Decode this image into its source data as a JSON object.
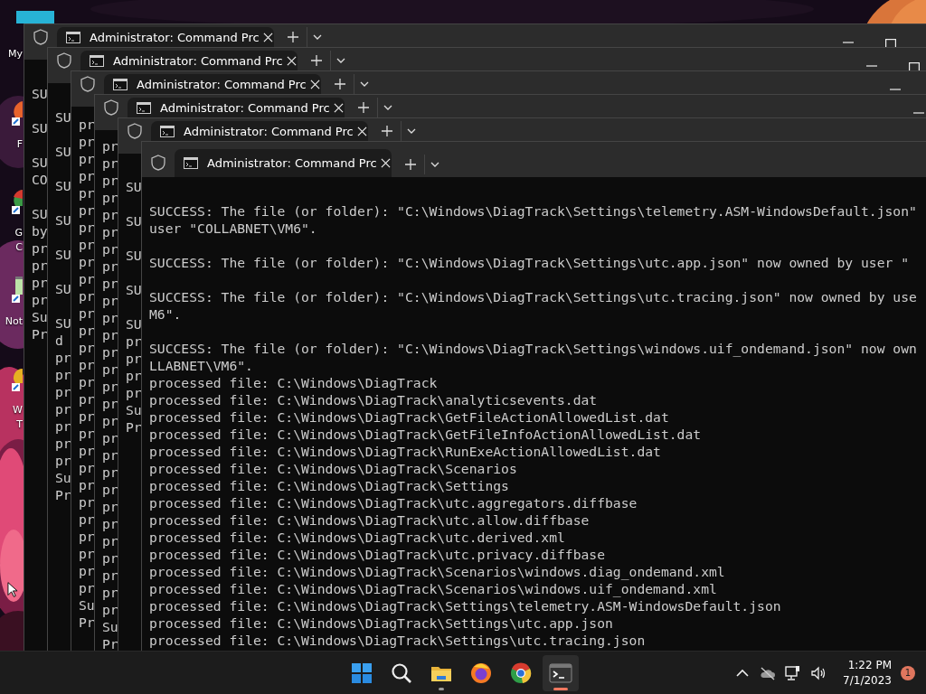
{
  "desktop": {
    "icons": [
      {
        "kind": "computer",
        "label_lines": [
          "My"
        ]
      },
      {
        "kind": "orange-app",
        "label_lines": [
          "F"
        ]
      },
      {
        "kind": "round-app",
        "label_lines": [
          "G",
          "C"
        ]
      },
      {
        "kind": "notepad",
        "label_lines": [
          "Not"
        ]
      },
      {
        "kind": "yellow-app",
        "label_lines": [
          "W",
          "T"
        ]
      }
    ]
  },
  "windows": [
    {
      "tab_title": "Administrator: Command Prc",
      "blocks": [
        [
          "SU"
        ],
        [
          "SU"
        ],
        [
          "SU",
          "CO"
        ],
        [
          "SU",
          "by",
          "pr",
          "pr",
          "pr",
          "pr",
          "Su",
          "Pr"
        ]
      ]
    },
    {
      "tab_title": "Administrator: Command Prc",
      "blocks": [
        [
          "SU"
        ],
        [
          "SU"
        ],
        [
          "SU"
        ],
        [
          "SU"
        ],
        [
          "SU"
        ],
        [
          "SU"
        ],
        [
          "SU",
          "d",
          "pr",
          "pr",
          "pr",
          "pr",
          "pr",
          "pr",
          "pr",
          "Su",
          "Pr"
        ]
      ]
    },
    {
      "tab_title": "Administrator: Command Prc",
      "blocks": [
        [
          "pr",
          "pr",
          "pr",
          "pr",
          "pr",
          "pr",
          "pr",
          "pr",
          "pr",
          "pr",
          "pr",
          "pr",
          "pr",
          "pr",
          "pr",
          "pr",
          "pr",
          "pr",
          "pr",
          "pr",
          "pr",
          "pr",
          "pr",
          "pr",
          "pr",
          "pr",
          "pr",
          "pr",
          "Su",
          "Pr"
        ]
      ]
    },
    {
      "tab_title": "Administrator: Command Prc",
      "blocks": [
        [
          "pr",
          "pr",
          "pr",
          "pr",
          "pr",
          "pr",
          "pr",
          "pr",
          "pr",
          "pr",
          "pr",
          "pr",
          "pr",
          "pr",
          "pr",
          "pr",
          "pr",
          "pr",
          "pr",
          "pr",
          "pr",
          "pr",
          "pr",
          "pr",
          "pr",
          "pr",
          "pr",
          "pr",
          "Su",
          "Pr"
        ]
      ]
    },
    {
      "tab_title": "Administrator: Command Prc",
      "blocks": [
        [
          "SU"
        ],
        [
          "SU"
        ],
        [
          "SU"
        ],
        [
          "SU"
        ],
        [
          "SU",
          "pr",
          "pr",
          "pr",
          "pr",
          "Su",
          "Pr"
        ]
      ]
    },
    {
      "tab_title": "Administrator: Command Prc",
      "blocks": [
        [
          "SUCCESS: The file (or folder): \"C:\\Windows\\DiagTrack\\Settings\\telemetry.ASM-WindowsDefault.json\"",
          "user \"COLLABNET\\VM6\"."
        ],
        [
          "SUCCESS: The file (or folder): \"C:\\Windows\\DiagTrack\\Settings\\utc.app.json\" now owned by user \""
        ],
        [
          "SUCCESS: The file (or folder): \"C:\\Windows\\DiagTrack\\Settings\\utc.tracing.json\" now owned by use",
          "M6\"."
        ],
        [
          "SUCCESS: The file (or folder): \"C:\\Windows\\DiagTrack\\Settings\\windows.uif_ondemand.json\" now own",
          "LLABNET\\VM6\".",
          "processed file: C:\\Windows\\DiagTrack",
          "processed file: C:\\Windows\\DiagTrack\\analyticsevents.dat",
          "processed file: C:\\Windows\\DiagTrack\\GetFileActionAllowedList.dat",
          "processed file: C:\\Windows\\DiagTrack\\GetFileInfoActionAllowedList.dat",
          "processed file: C:\\Windows\\DiagTrack\\RunExeActionAllowedList.dat",
          "processed file: C:\\Windows\\DiagTrack\\Scenarios",
          "processed file: C:\\Windows\\DiagTrack\\Settings",
          "processed file: C:\\Windows\\DiagTrack\\utc.aggregators.diffbase",
          "processed file: C:\\Windows\\DiagTrack\\utc.allow.diffbase",
          "processed file: C:\\Windows\\DiagTrack\\utc.derived.xml",
          "processed file: C:\\Windows\\DiagTrack\\utc.privacy.diffbase",
          "processed file: C:\\Windows\\DiagTrack\\Scenarios\\windows.diag_ondemand.xml",
          "processed file: C:\\Windows\\DiagTrack\\Scenarios\\windows.uif_ondemand.xml",
          "processed file: C:\\Windows\\DiagTrack\\Settings\\telemetry.ASM-WindowsDefault.json",
          "processed file: C:\\Windows\\DiagTrack\\Settings\\utc.app.json",
          "processed file: C:\\Windows\\DiagTrack\\Settings\\utc.tracing.json"
        ]
      ]
    }
  ],
  "taskbar": {
    "apps": [
      {
        "kind": "start",
        "running": false,
        "selected": false
      },
      {
        "kind": "search",
        "running": false,
        "selected": false
      },
      {
        "kind": "explorer",
        "running": true,
        "selected": false
      },
      {
        "kind": "firefox",
        "running": false,
        "selected": false
      },
      {
        "kind": "chrome",
        "running": false,
        "selected": false
      },
      {
        "kind": "terminal",
        "running": true,
        "selected": true
      }
    ],
    "tray": {
      "time": "1:22 PM",
      "date": "7/1/2023",
      "notifications": "1"
    }
  }
}
